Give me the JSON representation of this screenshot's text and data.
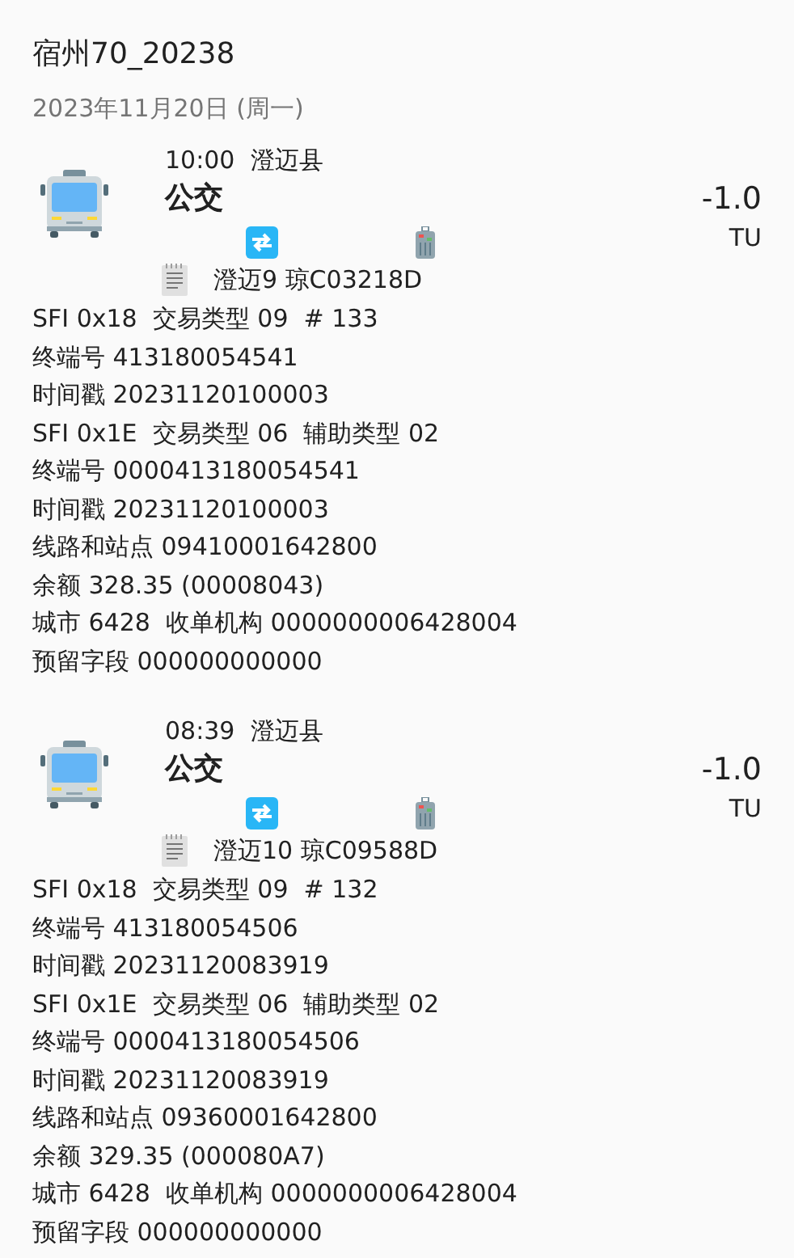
{
  "title": "宿州70_20238",
  "date": "2023年11月20日 (周一)",
  "transactions": [
    {
      "time_place": "10:00  澄迈县",
      "type": "公交",
      "amount": "-1.0",
      "currency": "TU",
      "route": "澄迈9 琼C03218D",
      "details": [
        "SFI 0x18  交易类型 09  # 133",
        "终端号 413180054541",
        "时间戳 20231120100003",
        "SFI 0x1E  交易类型 06  辅助类型 02",
        "终端号 0000413180054541",
        "时间戳 20231120100003",
        "线路和站点 09410001642800",
        "余额 328.35 (00008043)",
        "城市 6428  收单机构 0000000006428004",
        "预留字段 000000000000"
      ]
    },
    {
      "time_place": "08:39  澄迈县",
      "type": "公交",
      "amount": "-1.0",
      "currency": "TU",
      "route": "澄迈10 琼C09588D",
      "details": [
        "SFI 0x18  交易类型 09  # 132",
        "终端号 413180054506",
        "时间戳 20231120083919",
        "SFI 0x1E  交易类型 06  辅助类型 02",
        "终端号 0000413180054506",
        "时间戳 20231120083919",
        "线路和站点 09360001642800",
        "余额 329.35 (000080A7)",
        "城市 6428  收单机构 0000000006428004",
        "预留字段 000000000000"
      ]
    }
  ]
}
